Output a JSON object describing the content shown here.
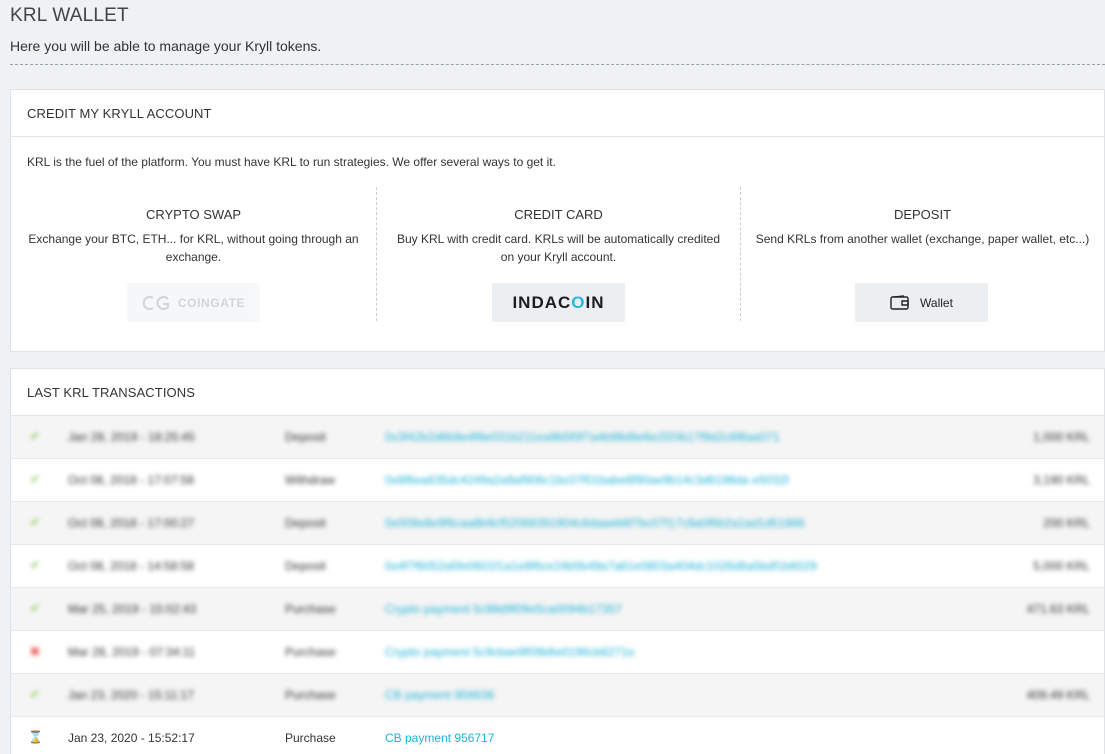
{
  "page": {
    "title": "KRL WALLET",
    "subtitle": "Here you will be able to manage your Kryll tokens."
  },
  "credit": {
    "header": "CREDIT MY KRYLL ACCOUNT",
    "intro": "KRL is the fuel of the platform. You must have KRL to run strategies. We offer several ways to get it.",
    "methods": [
      {
        "title": "CRYPTO SWAP",
        "description": "Exchange your BTC, ETH... for KRL, without going through an exchange.",
        "button_label": "COINGATE",
        "button_icon": "coingate-logo"
      },
      {
        "title": "CREDIT CARD",
        "description": "Buy KRL with credit card. KRLs will be automatically credited on your Kryll account.",
        "button_label_a": "INDAC",
        "button_label_accent": "O",
        "button_label_b": "IN",
        "button_icon": "indacoin-logo"
      },
      {
        "title": "DEPOSIT",
        "description": "Send KRLs from another wallet (exchange, paper wallet, etc...)",
        "button_label": "Wallet",
        "button_icon": "wallet-icon"
      }
    ]
  },
  "transactions": {
    "header": "LAST KRL TRANSACTIONS",
    "rows": [
      {
        "status": "success",
        "status_glyph": "✔",
        "date": "Jan 28, 2019 - 18:25:45",
        "type": "Deposit",
        "reference": "0x3f42b2d6b9e4f8e031b211ea9b5f0f7a4b98d8e6e2f20b17f9d2c6f8aa071",
        "amount": "1,000 KRL",
        "blurred": true
      },
      {
        "status": "success",
        "status_glyph": "✔",
        "date": "Oct 08, 2018 - 17:07:58",
        "type": "Withdraw",
        "reference": "0x8f6ea635dc4249a2a9af906c1bc07f01babe8f90ae9b14c3d6198da e5032f",
        "amount": "3,190 KRL",
        "blurred": true
      },
      {
        "status": "success",
        "status_glyph": "✔",
        "date": "Oct 08, 2018 - 17:00:27",
        "type": "Deposit",
        "reference": "0x009e8e9f6caa8b9cf52068391904c6daaeb6f7bc07f17c8a0f6b2a1ad1d51866",
        "amount": "200 KRL",
        "blurred": true
      },
      {
        "status": "success",
        "status_glyph": "✔",
        "date": "Oct 08, 2018 - 14:58:58",
        "type": "Deposit",
        "reference": "0x4f7f6052a5fe0601f1a1e8f6ce24b5b49a7a61e0803a404dc1026d6a5bdf1b6029",
        "amount": "5,000 KRL",
        "blurred": true
      },
      {
        "status": "success",
        "status_glyph": "✔",
        "date": "Mar 25, 2019 - 15:02:43",
        "type": "Purchase",
        "reference": "Crypto payment 5c98d9f09e5ca0094b17357",
        "amount": "471.63 KRL",
        "blurred": true
      },
      {
        "status": "failed",
        "status_glyph": "✖",
        "date": "Mar 28, 2019 - 07:34:11",
        "type": "Purchase",
        "reference": "Crypto payment 5c9cbae9f09b6e0196cb8271e",
        "amount": "",
        "blurred": true
      },
      {
        "status": "success",
        "status_glyph": "✔",
        "date": "Jan 23, 2020 - 15:11:17",
        "type": "Purchase",
        "reference": "CB payment 956636",
        "amount": "409.49 KRL",
        "blurred": true
      },
      {
        "status": "pending",
        "status_glyph": "⌛",
        "date": "Jan 23, 2020 - 15:52:17",
        "type": "Purchase",
        "reference": "CB payment 956717",
        "amount": "",
        "blurred": false
      }
    ]
  },
  "colors": {
    "link": "#1fb3d6",
    "success": "#7cc242",
    "error": "#e64a4a",
    "background": "#eef2f5"
  }
}
